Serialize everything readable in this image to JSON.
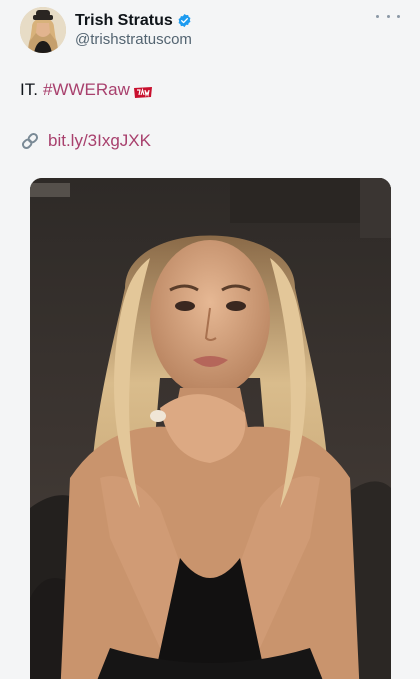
{
  "author": {
    "display_name": "Trish Stratus",
    "handle": "@trishstratuscom",
    "verified": true
  },
  "tweet": {
    "text_prefix": "IT.",
    "hashtag": "#WWERaw",
    "hashtag_emoji": "raw-logo-icon",
    "link_icon": "link-icon",
    "link": "bit.ly/3IxgJXK"
  },
  "colors": {
    "link_accent": "#a8406d",
    "verified_blue": "#1d9bf0",
    "raw_red": "#c8102e"
  },
  "icons": {
    "more": "more-dots-icon",
    "verified": "verified-badge-icon"
  }
}
